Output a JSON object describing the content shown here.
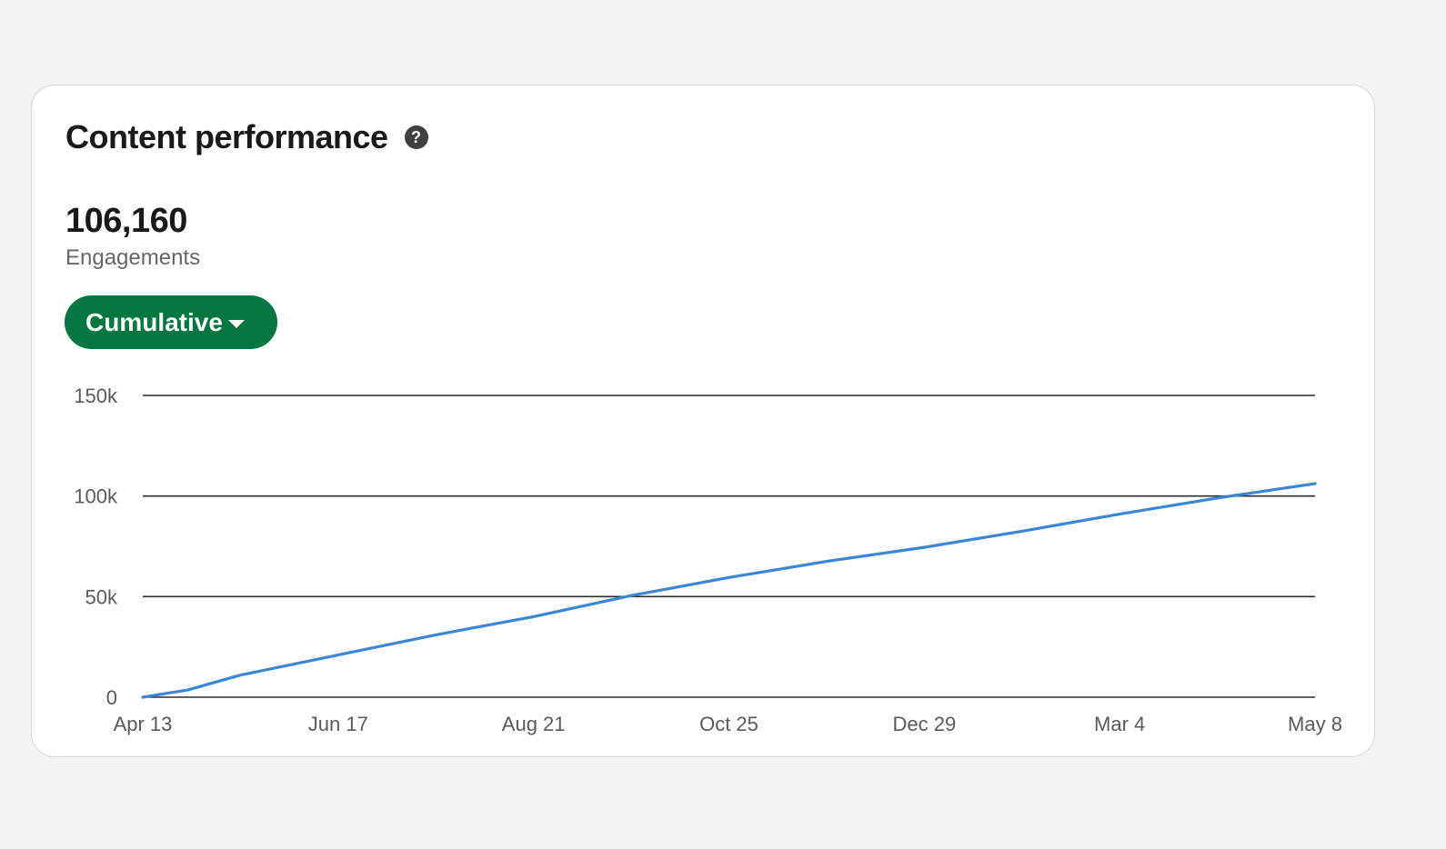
{
  "card": {
    "title": "Content performance",
    "help_icon": "question-circle-icon",
    "metric": {
      "value": "106,160",
      "label": "Engagements"
    },
    "mode_dropdown": {
      "label": "Cumulative",
      "icon": "caret-down-icon"
    }
  },
  "colors": {
    "accent": "#057642",
    "line": "#3b86d6",
    "grid": "#2b2b2b"
  },
  "chart_data": {
    "type": "line",
    "title": "",
    "xlabel": "",
    "ylabel": "",
    "x_tick_labels": [
      "Apr 13",
      "Jun 17",
      "Aug 21",
      "Oct 25",
      "Dec 29",
      "Mar 4",
      "May 8"
    ],
    "y_tick_labels": [
      "0",
      "50k",
      "100k",
      "150k"
    ],
    "y_ticks": [
      0,
      50000,
      100000,
      150000
    ],
    "ylim": [
      0,
      150000
    ],
    "grid": true,
    "legend": "none",
    "series": [
      {
        "x": [
          "Apr 13",
          "Apr 28",
          "May 15",
          "Jun 17",
          "Jul 20",
          "Aug 21",
          "Sep 22",
          "Oct 25",
          "Nov 27",
          "Dec 29",
          "Jan 31",
          "Mar 4",
          "Apr 5",
          "May 8"
        ],
        "values": [
          0,
          3600,
          11000,
          21000,
          31000,
          40000,
          50500,
          59500,
          67500,
          74500,
          82500,
          91000,
          99000,
          106160
        ]
      }
    ]
  }
}
